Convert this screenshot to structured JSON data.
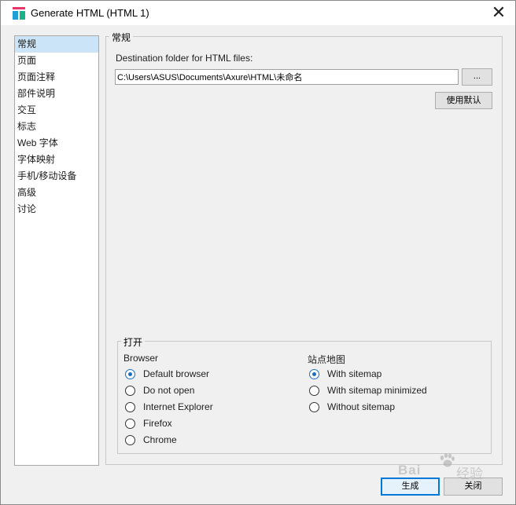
{
  "window": {
    "title": "Generate HTML (HTML 1)",
    "close_glyph": "✕"
  },
  "sidebar": {
    "items": [
      {
        "label": "常规",
        "active": true
      },
      {
        "label": "页面"
      },
      {
        "label": "页面注释"
      },
      {
        "label": "部件说明"
      },
      {
        "label": "交互"
      },
      {
        "label": "标志"
      },
      {
        "label": "Web 字体"
      },
      {
        "label": "字体映射"
      },
      {
        "label": "手机/移动设备"
      },
      {
        "label": "高级"
      },
      {
        "label": "讨论"
      }
    ]
  },
  "general": {
    "legend": "常规",
    "destination_label": "Destination folder for HTML files:",
    "destination_value": "C:\\Users\\ASUS\\Documents\\Axure\\HTML\\未命名",
    "browse_label": "...",
    "use_default_label": "使用默认"
  },
  "open": {
    "legend": "打开",
    "browser_heading": "Browser",
    "browser_options": [
      {
        "label": "Default browser",
        "checked": true
      },
      {
        "label": "Do not open",
        "checked": false
      },
      {
        "label": "Internet Explorer",
        "checked": false
      },
      {
        "label": "Firefox",
        "checked": false
      },
      {
        "label": "Chrome",
        "checked": false
      }
    ],
    "sitemap_heading": "站点地图",
    "sitemap_options": [
      {
        "label": "With sitemap",
        "checked": true
      },
      {
        "label": "With sitemap minimized",
        "checked": false
      },
      {
        "label": "Without sitemap",
        "checked": false
      }
    ]
  },
  "footer": {
    "generate_label": "生成",
    "close_label": "关闭"
  },
  "watermark": {
    "brand": "Bai",
    "suffix": "经验"
  },
  "colors": {
    "accent": "#0078d7",
    "selection": "#cce4f7",
    "dialog_bg": "#f0f0f0",
    "radio_checked": "#1a6fc4"
  }
}
